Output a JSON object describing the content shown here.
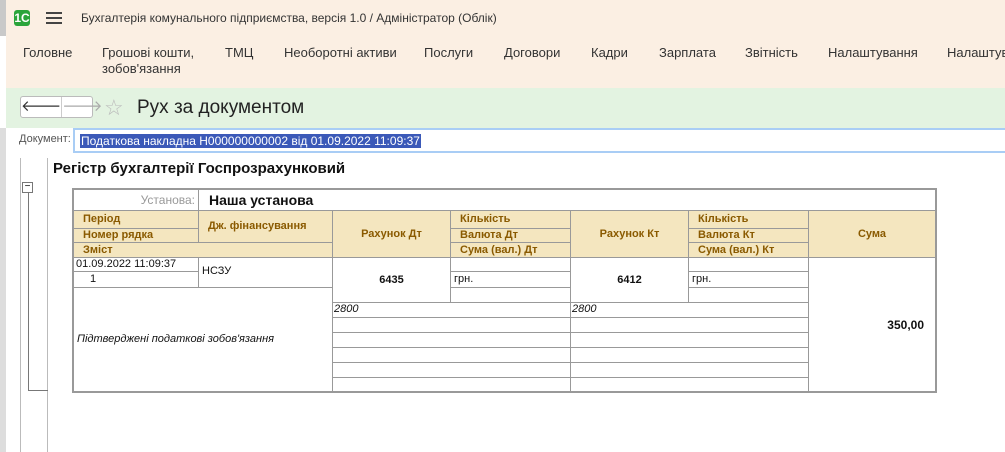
{
  "app": {
    "title": "Бухгалтерія комунального підприємства, версія 1.0 / Адміністратор  (Облік)",
    "logo": "1С"
  },
  "menu": [
    "Головне",
    "Грошові кошти,\nзобов'язання",
    "ТМЦ",
    "Необоротні активи",
    "Послуги",
    "Договори",
    "Кадри",
    "Зарплата",
    "Звітність",
    "Налаштування",
    "Налаштування"
  ],
  "page": {
    "title": "Рух за документом",
    "back": "🡐",
    "forward": "🡒",
    "star": "☆"
  },
  "document": {
    "label": "Документ:",
    "value": "Податкова накладна Н000000000002 від 01.09.2022 11:09:37"
  },
  "register": {
    "title": "Регістр бухгалтерії Госпрозрахунковий",
    "institution_label": "Установа:",
    "institution": "Наша установа",
    "headers": {
      "period": "Період",
      "row_no": "Номер рядка",
      "content": "Зміст",
      "fund": "Дж. фінансування",
      "acc_dt": "Рахунок Дт",
      "qty_dt": "Кількість",
      "cur_dt": "Валюта Дт",
      "sum_cur_dt": "Сума (вал.) Дт",
      "acc_kt": "Рахунок Кт",
      "qty_kt": "Кількість",
      "cur_kt": "Валюта Кт",
      "sum_cur_kt": "Сума (вал.) Кт",
      "sum": "Сума"
    },
    "row": {
      "period": "01.09.2022 11:09:37",
      "row_no": "1",
      "fund": "НСЗУ",
      "content": "Підтверджені податкові зобов'язання",
      "acc_dt": "6435",
      "cur_dt": "грн.",
      "subconto_dt": "2800",
      "acc_kt": "6412",
      "cur_kt": "грн.",
      "subconto_kt": "2800",
      "sum": "350,00"
    }
  },
  "collapse_icon": "−"
}
